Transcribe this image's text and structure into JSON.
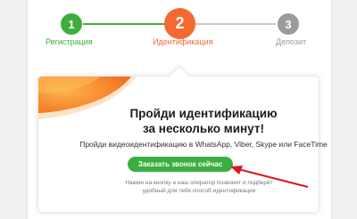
{
  "steps": [
    {
      "number": "1",
      "label": "Регистрация",
      "state": "done",
      "color": "#3cae3f"
    },
    {
      "number": "2",
      "label": "Идентификация",
      "state": "active",
      "color": "#f26a2f"
    },
    {
      "number": "3",
      "label": "Депозит",
      "state": "pending",
      "color": "#9b9b9b"
    }
  ],
  "card": {
    "title_line1": "Пройди идентификацию",
    "title_line2": "за несколько минут!",
    "subtitle": "Пройди видеоидентификацию в WhatsApp, Viber, Skype или FaceTime",
    "button_label": "Заказать звонок сейчас",
    "hint_line1": "Нажми на кнопку и наш оператор позвонит и подберёт",
    "hint_line2": "удобный для тебя способ идентификации"
  },
  "colors": {
    "accent_green": "#3cae3f",
    "accent_orange": "#f26a2f",
    "annotation_red": "#d8191f"
  }
}
